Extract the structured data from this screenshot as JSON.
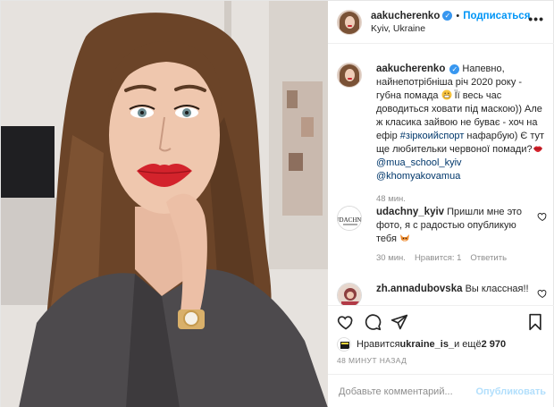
{
  "header": {
    "username": "aakucherenko",
    "separator": "•",
    "follow_label": "Подписаться",
    "location": "Kyiv, Ukraine",
    "more_label": "•••"
  },
  "caption": {
    "username": "aakucherenko",
    "text_1": "Напевно, найнепотрібніша річ 2020 року - губна помада",
    "text_2": " Її весь час доводиться ховати під маскою)) Але ж класика зайвою не буває - хоч на ефір ",
    "hashtag": "#зіркоийспорт",
    "text_3": " нафарбую) Є тут ще любительки червоної помади?",
    "mention_1": "@mua_school_kyiv",
    "mention_2": "@khomyakovamua",
    "time": "48 мин."
  },
  "comments": [
    {
      "username": "udachny_kyiv",
      "text": "Пришли мне это фото, я с радостью опубликую тебя",
      "time": "30 мин.",
      "likes": "Нравится: 1",
      "reply": "Ответить"
    },
    {
      "username": "zh.annadubovska",
      "text": "Вы классная!!"
    }
  ],
  "likes": {
    "prefix": "Нравится ",
    "user": "ukraine_is_",
    "middle": " и ещё ",
    "count": "2 970"
  },
  "time_ago": "48 МИНУТ НАЗАД",
  "add_comment": {
    "placeholder": "Добавьте комментарий...",
    "publish_label": "Опубликовать"
  },
  "icons": [
    "heart-icon",
    "comment-icon",
    "share-icon",
    "bookmark-icon",
    "verified-icon",
    "more-icon"
  ],
  "colors": {
    "accent": "#0095f6",
    "verified": "#3897f0",
    "lips": "#d3232c",
    "muted": "#8e8e8e"
  }
}
